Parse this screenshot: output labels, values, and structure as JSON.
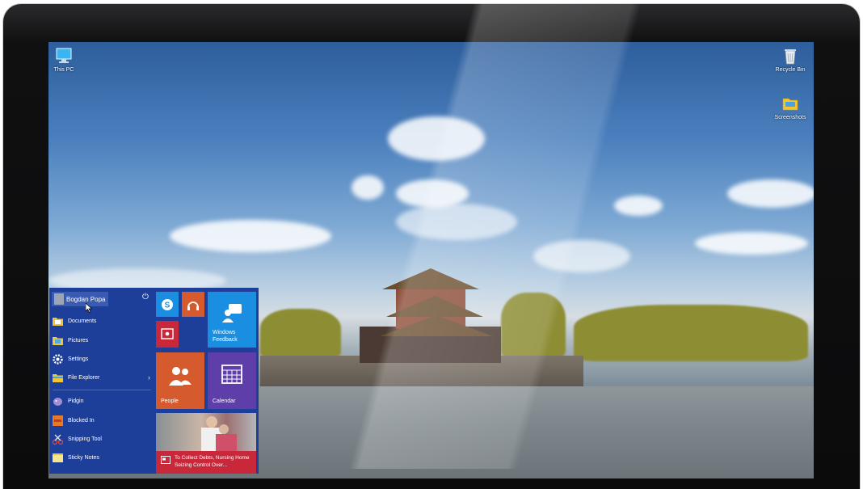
{
  "desktop": {
    "icons": [
      {
        "label": "This PC"
      },
      {
        "label": "Recycle Bin"
      },
      {
        "label": "Screenshots"
      }
    ]
  },
  "start_menu": {
    "user": "Bogdan Popa",
    "items": [
      {
        "label": "Documents"
      },
      {
        "label": "Pictures"
      },
      {
        "label": "Settings"
      },
      {
        "label": "File Explorer"
      },
      {
        "label": "Pidgin"
      },
      {
        "label": "Blocked In"
      },
      {
        "label": "Snipping Tool"
      },
      {
        "label": "Sticky Notes"
      }
    ],
    "tiles": {
      "feedback": "Windows Feedback",
      "people": "People",
      "calendar": "Calendar",
      "news": "To Collect Debts, Nursing Home Seizing Control Over..."
    }
  },
  "colors": {
    "start_bg": "#1e3f99",
    "tile_blue": "#1a8ee0",
    "tile_red": "#c9283a",
    "tile_orange": "#d55b2f",
    "tile_purple": "#5e3ea9"
  }
}
